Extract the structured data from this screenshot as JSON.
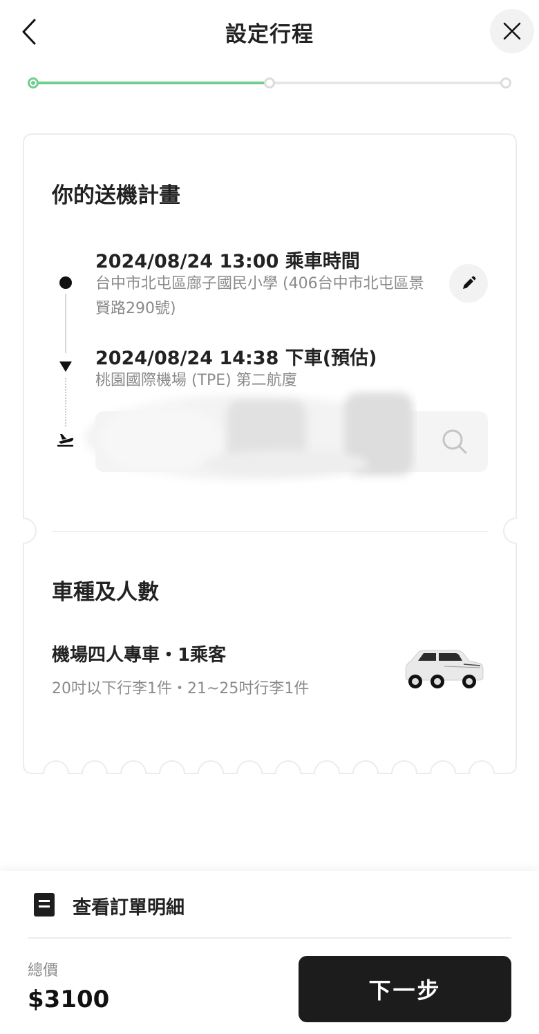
{
  "header": {
    "title": "設定行程",
    "back_icon": "chevron-left-icon",
    "close_icon": "close-icon"
  },
  "progress": {
    "current_step": 2,
    "total_steps": 3,
    "fill_fraction": 0.5
  },
  "plan": {
    "title": "你的送機計畫",
    "pickup": {
      "time_label": "2024/08/24 13:00 乘車時間",
      "address": "台中市北屯區廍子國民小學 (406台中市北屯區景賢路290號)"
    },
    "dropoff": {
      "time_label": "2024/08/24 14:38 下車(預估)",
      "address": "桃園國際機場 (TPE) 第二航廈"
    },
    "flight_input": {
      "value": "",
      "icon": "search-icon"
    },
    "edit_icon": "pencil-icon"
  },
  "vehicle": {
    "title": "車種及人數",
    "name": "機場四人專車・1乘客",
    "luggage": "20吋以下行李1件・21~25吋行李1件"
  },
  "bottom": {
    "detail_label": "查看訂單明細",
    "total_label": "總價",
    "total_price": "$3100",
    "next_label": "下一步"
  },
  "colors": {
    "accent": "#6fcf8f",
    "primary_button": "#1c1c1c",
    "muted_text": "#8a8a8a"
  }
}
